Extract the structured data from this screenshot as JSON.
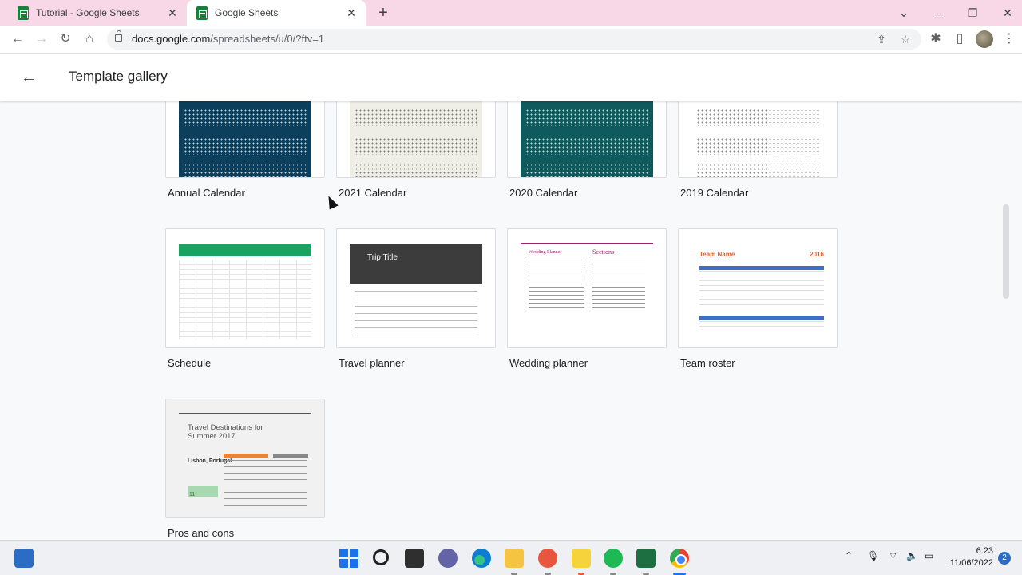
{
  "browser": {
    "tabs": [
      {
        "title": "Tutorial - Google Sheets",
        "active": false
      },
      {
        "title": "Google Sheets",
        "active": true
      }
    ],
    "url_host": "docs.google.com",
    "url_path": "/spreadsheets/u/0/?ftv=1",
    "window_controls": {
      "minimize": "—",
      "restore": "❐",
      "close": "✕"
    }
  },
  "header": {
    "title": "Template gallery"
  },
  "templates": [
    {
      "name": "Annual Calendar"
    },
    {
      "name": "2021 Calendar"
    },
    {
      "name": "2020 Calendar"
    },
    {
      "name": "2019 Calendar"
    },
    {
      "name": "Schedule"
    },
    {
      "name": "Travel planner"
    },
    {
      "name": "Wedding planner"
    },
    {
      "name": "Team roster"
    },
    {
      "name": "Pros and cons"
    }
  ],
  "thumbnails": {
    "trip_title": "Trip Title",
    "wedding_title": "Wedding Planner",
    "wedding_sections": "Sections",
    "roster_title": "Team Name",
    "roster_year": "2016",
    "pros_title": "Travel Destinations for Summer 2017",
    "pros_city": "Lisbon, Portugal",
    "pros_score": "11"
  },
  "taskbar": {
    "time": "6:23",
    "date": "11/06/2022",
    "notification_count": "2"
  },
  "colors": {
    "sheets_green": "#188038",
    "tab_strip": "#f8d7e6",
    "accent_blue": "#1a73e8"
  }
}
